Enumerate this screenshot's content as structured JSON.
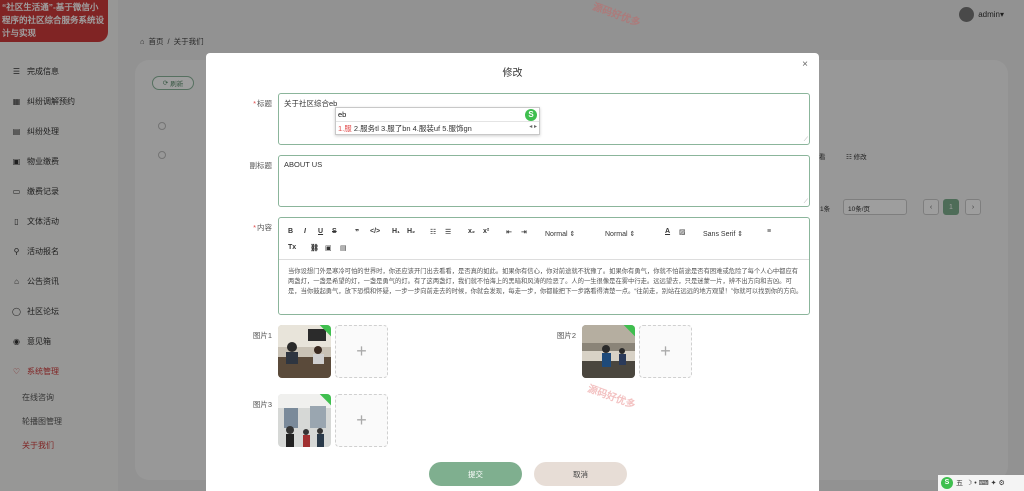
{
  "sidebar": {
    "brand": "“社区生活通”-基于微信小程序的社区综合服务系统设计与实现",
    "items": [
      {
        "label": "完成信息",
        "icon": "list-icon"
      },
      {
        "label": "纠纷调解预约",
        "icon": "calendar-icon"
      },
      {
        "label": "纠纷处理",
        "icon": "document-icon"
      },
      {
        "label": "物业缴费",
        "icon": "wallet-icon"
      },
      {
        "label": "缴费记录",
        "icon": "record-icon"
      },
      {
        "label": "文体活动",
        "icon": "file-icon"
      },
      {
        "label": "活动报名",
        "icon": "link-icon"
      },
      {
        "label": "公告资讯",
        "icon": "shop-icon"
      },
      {
        "label": "社区论坛",
        "icon": "apple-icon"
      },
      {
        "label": "意见箱",
        "icon": "circle-icon"
      },
      {
        "label": "系统管理",
        "icon": "heart-icon"
      }
    ],
    "subitems": [
      "在线咨询",
      "轮播图管理",
      "关于我们"
    ]
  },
  "header": {
    "user": "admin"
  },
  "breadcrumb": {
    "home": "首页",
    "sep": "/",
    "current": "关于我们"
  },
  "background": {
    "refresh": "刷新",
    "col_view": "看",
    "col_edit": "修改",
    "total": "1条",
    "page_size": "10条/页",
    "page": "1",
    "prev": "‹",
    "next": "›"
  },
  "modal": {
    "title": "修改",
    "close": "×",
    "title_label": "标题",
    "title_value": "关于社区综合eb",
    "subtitle_label": "副标题",
    "subtitle_value": "ABOUT US",
    "content_label": "内容",
    "content_text": "当你设想门外是寒冷可怕的世界时，你还应该开门出去看看，是否真的如此。如果你有信心，你对前途就不犹豫了。如果你有勇气，你就不怕前途是否有困难或危险了每个人心中都应有两盏灯，一盏是希望的灯，一盏是勇气的灯。有了这两盏灯，我们就不怕海上的黑暗和风涛的险恶了。人的一生很像是在雾中行走。远远望去，只是迷蒙一片，辨不出方向和吉凶。可是，当你鼓起勇气，放下恐惧和怀疑，一步一步向前走去的时候，你就会发现，每走一步，你都能把下一步路看得清楚一点。“往前走，别站在远远的地方观望！”你就可以找到你的方向。",
    "image1_label": "图片1",
    "image2_label": "图片2",
    "image3_label": "图片3",
    "add_symbol": "+",
    "submit": "提交",
    "cancel": "取消",
    "toolbar": {
      "bold": "B",
      "italic": "I",
      "underline": "U",
      "strike": "S",
      "quote": "❞",
      "code": "</>",
      "h1": "H₁",
      "h2": "H₂",
      "ol": "☷",
      "ul": "☰",
      "sub": "x₂",
      "sup": "x²",
      "outdent": "⇤",
      "indent": "⇥",
      "size": "Normal",
      "header": "Normal",
      "font": "Sans Serif",
      "color": "A",
      "bg": "▨",
      "align": "≡",
      "clean": "Tx",
      "link": "🔗",
      "image": "▣",
      "video": "▤"
    }
  },
  "ime": {
    "composition": "eb",
    "candidates_first": "1.服",
    "candidates_rest": " 2.服务tl  3.服了bn  4.服装uf  5.服饰gn",
    "logo": "S"
  },
  "tray": {
    "logo": "S",
    "mode": "五",
    "icons": "☽ • ⌨ ✦ ⚙"
  },
  "watermark": "源码好优多"
}
